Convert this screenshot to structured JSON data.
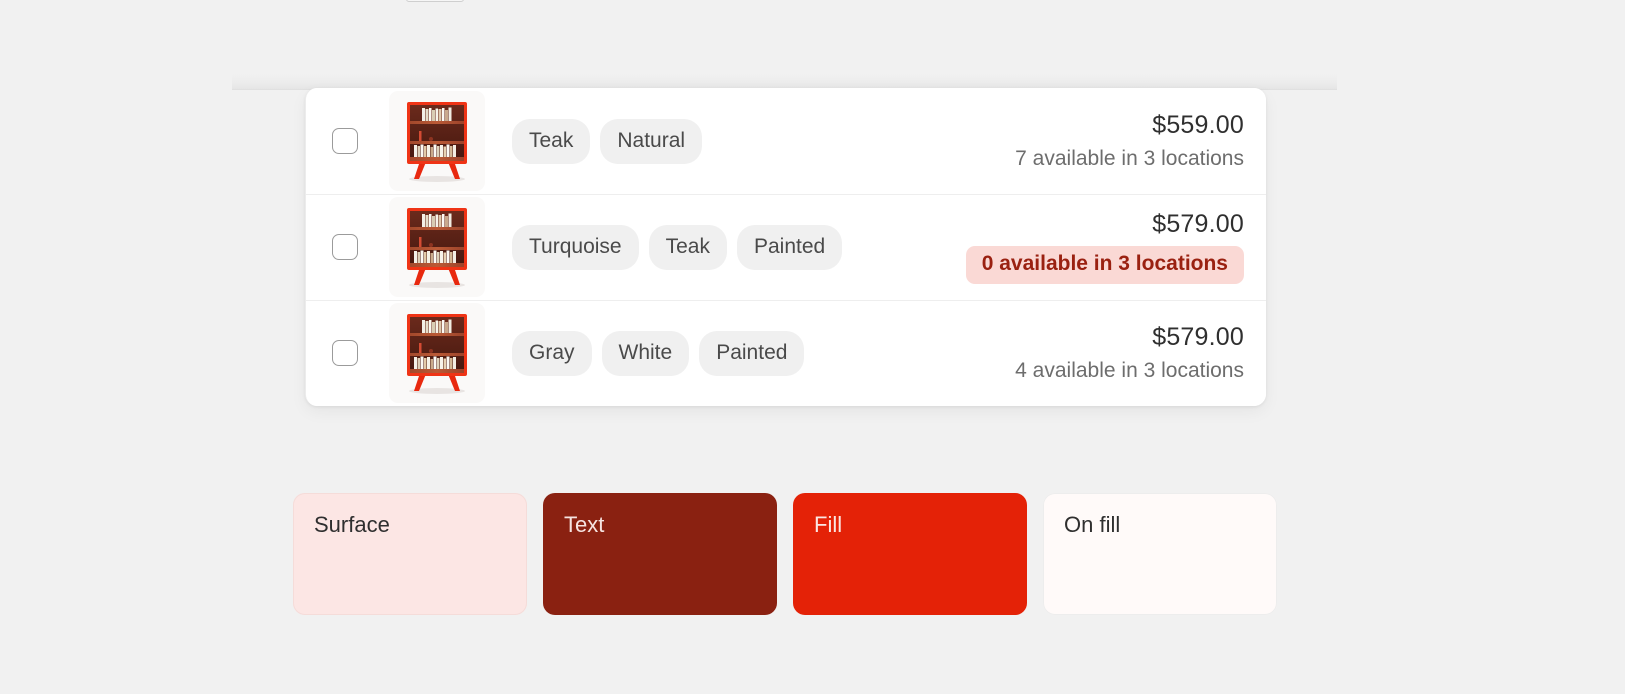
{
  "product_list": {
    "rows": [
      {
        "checkbox_checked": false,
        "thumbnail": "bookshelf-thumbnail",
        "tags": [
          "Teak",
          "Natural"
        ],
        "price": "$559.00",
        "availability": "7 available in 3 locations",
        "availability_highlighted": false
      },
      {
        "checkbox_checked": false,
        "thumbnail": "bookshelf-thumbnail",
        "tags": [
          "Turquoise",
          "Teak",
          "Painted"
        ],
        "price": "$579.00",
        "availability": "0 available in 3 locations",
        "availability_highlighted": true
      },
      {
        "checkbox_checked": false,
        "thumbnail": "bookshelf-thumbnail",
        "tags": [
          "Gray",
          "White",
          "Painted"
        ],
        "price": "$579.00",
        "availability": "4 available in 3 locations",
        "availability_highlighted": false
      }
    ]
  },
  "color_swatches": [
    {
      "label": "Surface",
      "hex": "#FCE6E4"
    },
    {
      "label": "Text",
      "hex": "#8A2111"
    },
    {
      "label": "Fill",
      "hex": "#E42207"
    },
    {
      "label": "On fill",
      "hex": "#FFFAF9"
    }
  ],
  "theme": {
    "page_background": "#F1F1F1",
    "card_background": "#FFFFFF",
    "chip_background": "#F0F0F0",
    "chip_text": "#4A4A4A",
    "price_text": "#2F2F2F",
    "availability_text": "#6D6D6D",
    "badge_background": "#FAD9D5",
    "badge_text": "#9A2111"
  }
}
